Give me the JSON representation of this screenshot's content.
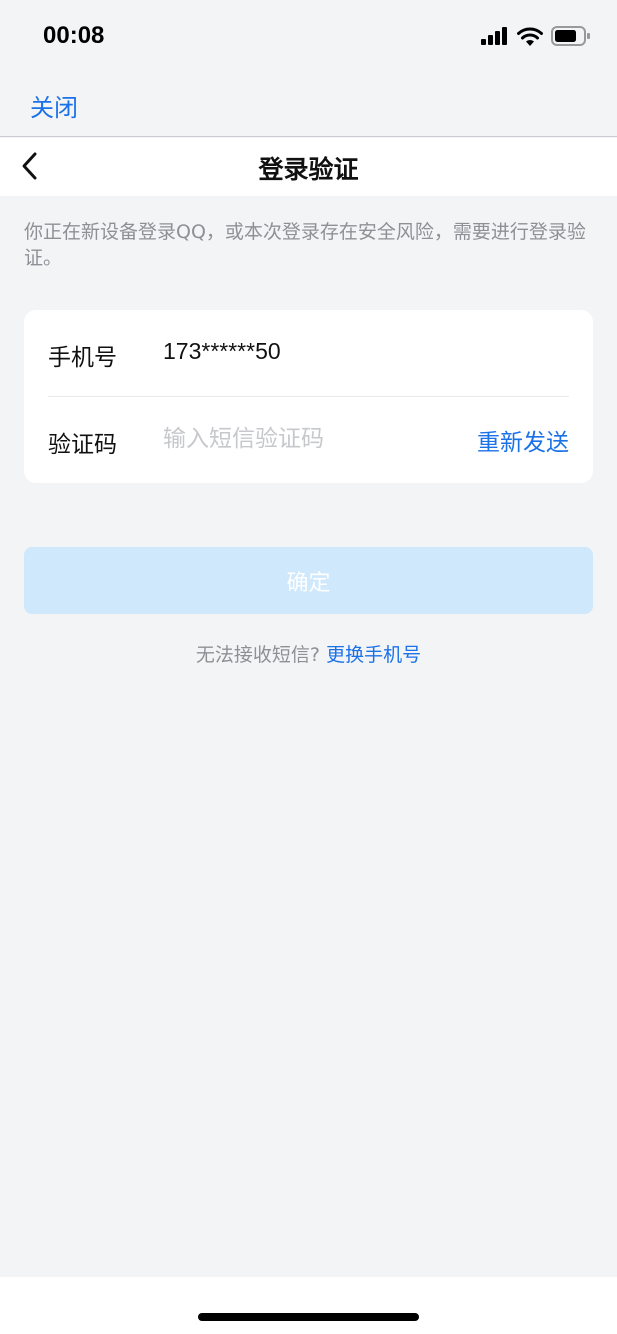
{
  "status_bar": {
    "time": "00:08"
  },
  "top_bar": {
    "close_label": "关闭"
  },
  "nav": {
    "title": "登录验证"
  },
  "notice": "你正在新设备登录QQ，或本次登录存在安全风险，需要进行登录验证。",
  "form": {
    "phone_label": "手机号",
    "phone_value": "173******50",
    "code_label": "验证码",
    "code_placeholder": "输入短信验证码",
    "code_value": "",
    "resend_label": "重新发送"
  },
  "confirm_label": "确定",
  "help": {
    "text": "无法接收短信?",
    "link": "更换手机号"
  },
  "colors": {
    "accent": "#1b72e8",
    "button_disabled": "#cfe8fb",
    "background": "#f3f4f6"
  }
}
